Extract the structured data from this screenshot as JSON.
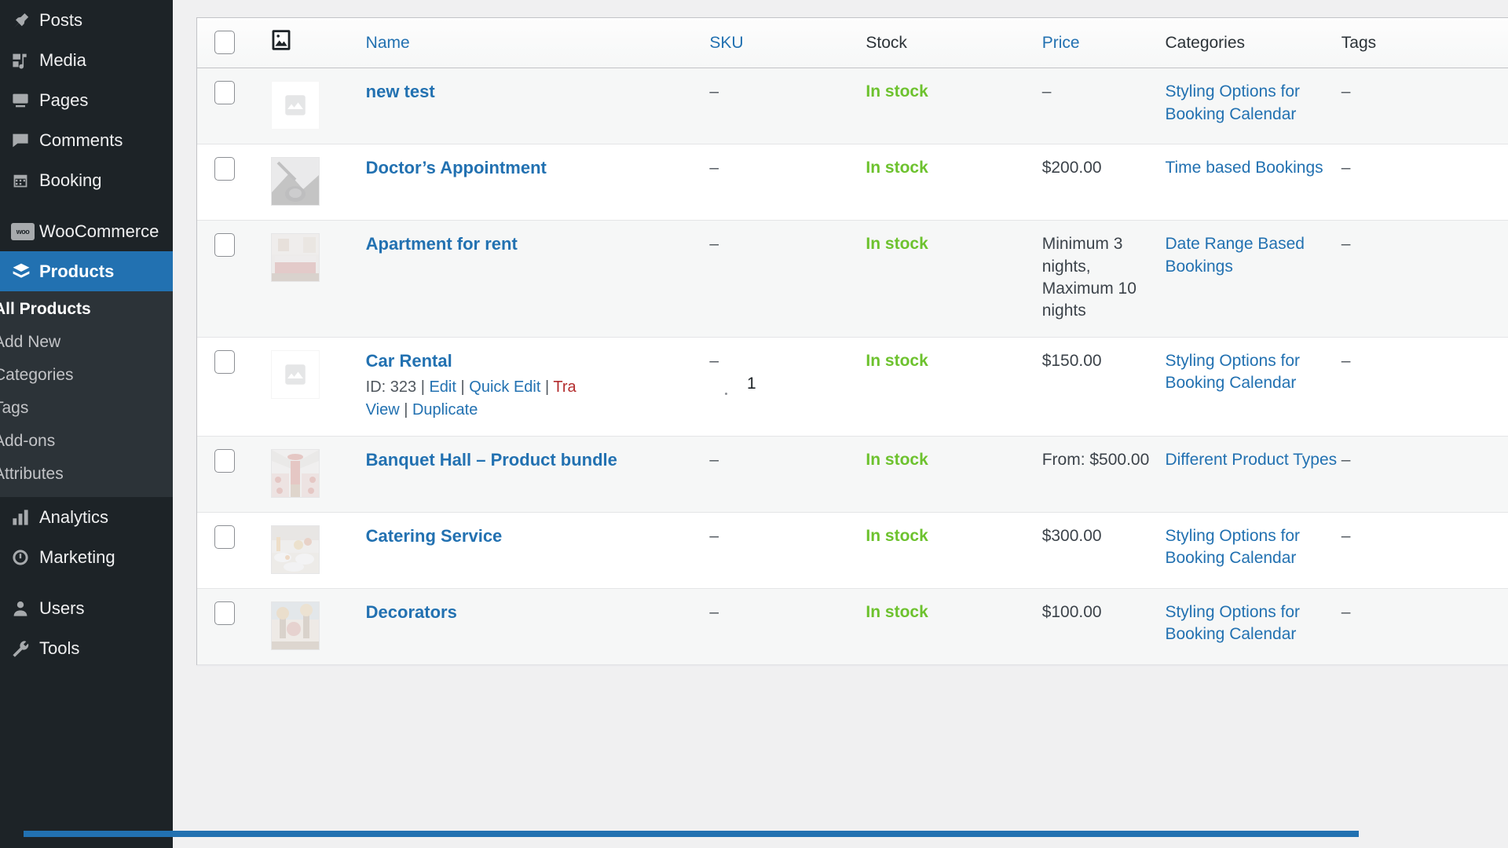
{
  "sidebar": {
    "items": [
      {
        "label": "Posts",
        "icon": "pin-icon",
        "current": false
      },
      {
        "label": "Media",
        "icon": "media-icon",
        "current": false
      },
      {
        "label": "Pages",
        "icon": "page-icon",
        "current": false
      },
      {
        "label": "Comments",
        "icon": "comment-icon",
        "current": false
      },
      {
        "label": "Booking",
        "icon": "calendar-icon",
        "current": false
      },
      {
        "label": "WooCommerce",
        "icon": "woo-icon",
        "current": false
      },
      {
        "label": "Products",
        "icon": "products-box-icon",
        "current": true
      },
      {
        "label": "Analytics",
        "icon": "chart-bar-icon",
        "current": false
      },
      {
        "label": "Marketing",
        "icon": "megaphone-icon",
        "current": false
      },
      {
        "label": "Users",
        "icon": "user-icon",
        "current": false
      },
      {
        "label": "Tools",
        "icon": "wrench-icon",
        "current": false
      }
    ],
    "submenu": [
      {
        "label": "All Products",
        "current": true
      },
      {
        "label": "Add New",
        "current": false
      },
      {
        "label": "Categories",
        "current": false
      },
      {
        "label": "Tags",
        "current": false
      },
      {
        "label": "Add-ons",
        "current": false
      },
      {
        "label": "Attributes",
        "current": false
      }
    ]
  },
  "table": {
    "headers": {
      "thumbnail_icon": "image-icon",
      "name": "Name",
      "sku": "SKU",
      "stock": "Stock",
      "price": "Price",
      "categories": "Categories",
      "tags": "Tags"
    },
    "sortable": [
      "Name",
      "SKU",
      "Price"
    ],
    "rows": [
      {
        "title": "new test",
        "thumb": "placeholder",
        "sku": "–",
        "stock": "In stock",
        "price": "–",
        "categories": "Styling Options for Booking Calendar",
        "tags": "–",
        "actions": null
      },
      {
        "title": "Doctor’s Appointment",
        "thumb": "stethoscope",
        "sku": "–",
        "stock": "In stock",
        "price": "$200.00",
        "categories": "Time based Bookings",
        "tags": "–",
        "actions": null
      },
      {
        "title": "Apartment for rent",
        "thumb": "bedroom",
        "sku": "–",
        "stock": "In stock",
        "price": "Minimum 3 nights, Maximum 10 nights",
        "categories": "Date Range Based Bookings",
        "tags": "–",
        "actions": null
      },
      {
        "title": "Car Rental",
        "thumb": "placeholder",
        "sku": "–",
        "stock": "In stock",
        "price": "$150.00",
        "categories": "Styling Options for Booking Calendar",
        "tags": "–",
        "actions": {
          "id_label": "ID: 323",
          "edit": "Edit",
          "quick_edit": "Quick Edit",
          "trash": "Tra",
          "view": "View",
          "duplicate": "Duplicate",
          "separator": "|"
        }
      },
      {
        "title": "Banquet Hall – Product bundle",
        "thumb": "banquet",
        "sku": "–",
        "stock": "In stock",
        "price": "From: $500.00",
        "categories": "Different Product Types",
        "tags": "–",
        "actions": null
      },
      {
        "title": "Catering Service",
        "thumb": "catering",
        "sku": "–",
        "stock": "In stock",
        "price": "$300.00",
        "categories": "Styling Options for Booking Calendar",
        "tags": "–",
        "actions": null
      },
      {
        "title": "Decorators",
        "thumb": "decorators",
        "sku": "–",
        "stock": "In stock",
        "price": "$100.00",
        "categories": "Styling Options for Booking Calendar",
        "tags": "–",
        "actions": null
      }
    ]
  },
  "overlay": {
    "number": "1"
  },
  "colors": {
    "accent": "#2271b1",
    "sidebar_bg": "#1d2327",
    "submenu_bg": "#2c3338",
    "in_stock_green": "#6dc22e",
    "trash_red": "#b32d2e"
  }
}
